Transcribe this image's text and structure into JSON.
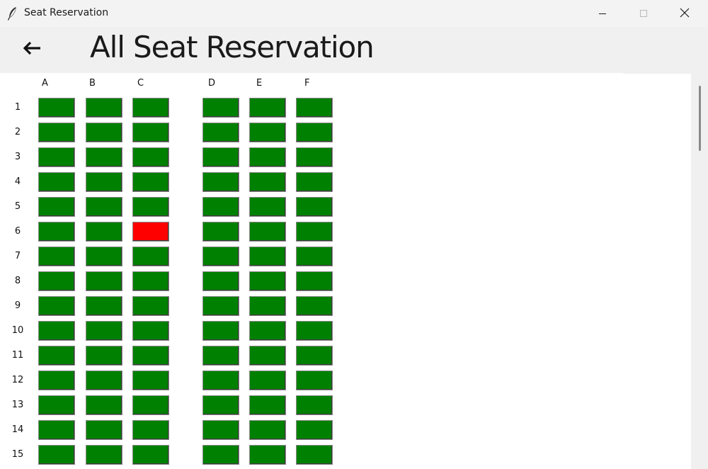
{
  "window": {
    "title": "Seat Reservation",
    "icon": "feather-icon",
    "controls": [
      "minimize-icon",
      "maximize-icon",
      "close-icon"
    ]
  },
  "header": {
    "back_icon": "arrow-left-icon",
    "title": "All Seat Reservation"
  },
  "seat_map": {
    "columns": [
      "A",
      "B",
      "C",
      "D",
      "E",
      "F"
    ],
    "rows": [
      "1",
      "2",
      "3",
      "4",
      "5",
      "6",
      "7",
      "8",
      "9",
      "10",
      "11",
      "12",
      "13",
      "14",
      "15"
    ],
    "reserved": [
      {
        "row": "6",
        "col": "C"
      }
    ],
    "colors": {
      "available": "#008000",
      "reserved": "#ff0000"
    }
  }
}
